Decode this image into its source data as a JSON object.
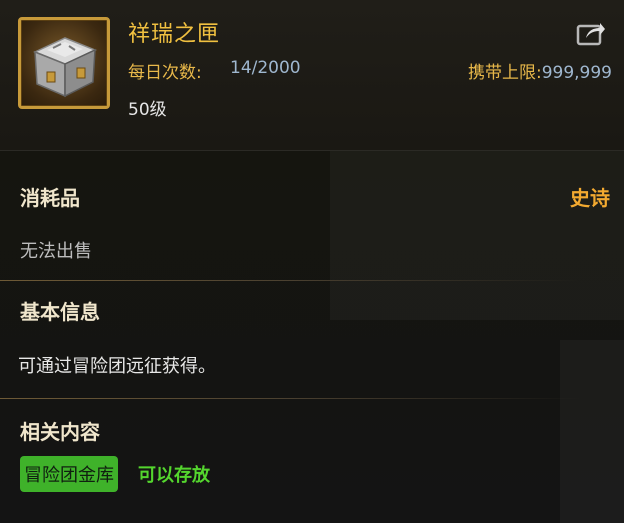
{
  "item": {
    "name": "祥瑞之匣",
    "daily_label": "每日次数:",
    "daily_value": "14/2000",
    "limit_label": "携带上限:",
    "limit_value": "999,999",
    "level": "50级",
    "icon": "silver-treasure-chest-icon"
  },
  "category": {
    "label": "消耗品",
    "rarity": "史诗",
    "sell_status": "无法出售"
  },
  "basic_info": {
    "title": "基本信息",
    "description": "可通过冒险团远征获得。"
  },
  "related": {
    "title": "相关内容",
    "badge": "冒险团金库",
    "badge_note": "可以存放"
  },
  "colors": {
    "title_gold": "#f0c040",
    "label_gold": "#e8b84a",
    "value_blue": "#9fb7cf",
    "rarity_orange": "#f2a930",
    "badge_green": "#3fb22a",
    "note_green": "#54d62e"
  }
}
